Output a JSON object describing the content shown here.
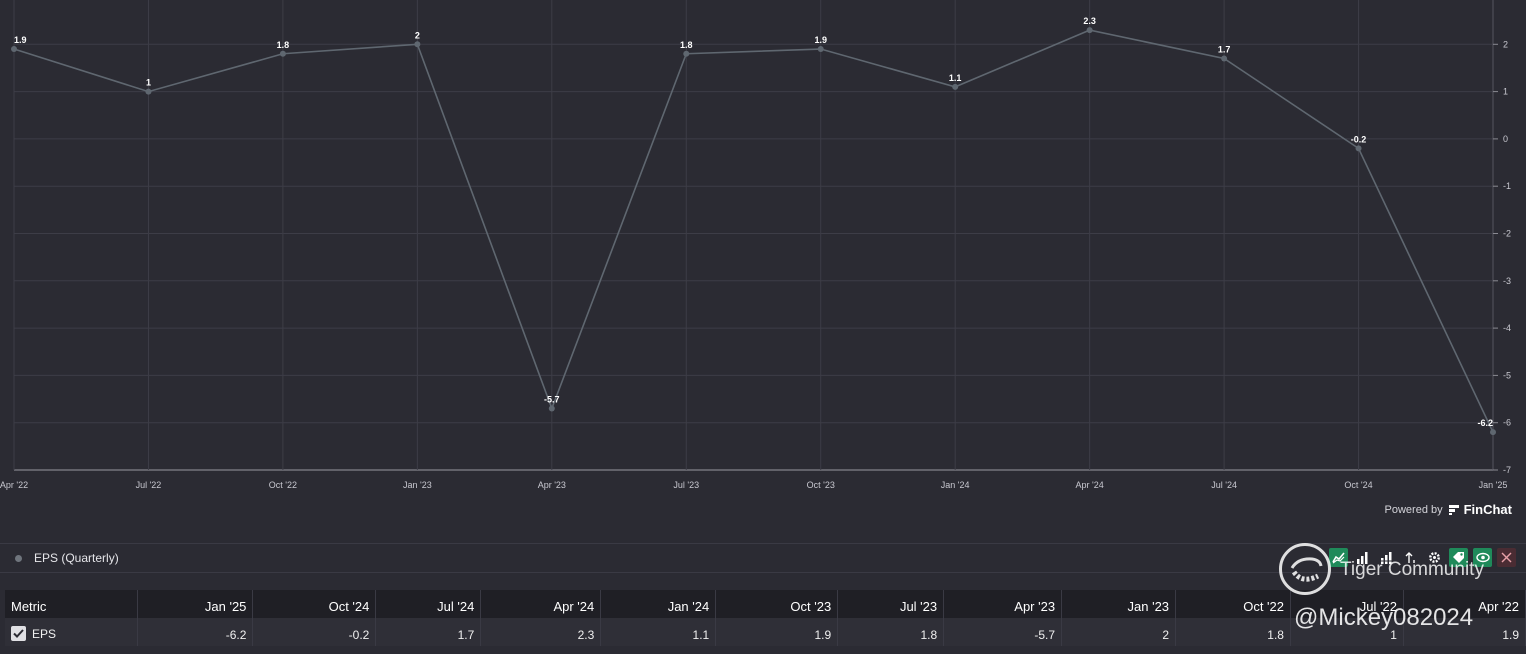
{
  "chart_data": {
    "type": "line",
    "x": [
      "Apr '22",
      "Jul '22",
      "Oct '22",
      "Jan '23",
      "Apr '23",
      "Jul '23",
      "Oct '23",
      "Jan '24",
      "Apr '24",
      "Jul '24",
      "Oct '24",
      "Jan '25"
    ],
    "series": [
      {
        "name": "EPS (Quarterly)",
        "values": [
          1.9,
          1,
          1.8,
          2,
          -5.7,
          1.8,
          1.9,
          1.1,
          2.3,
          1.7,
          -0.2,
          -6.2
        ]
      }
    ],
    "data_labels": [
      "1.9",
      "1",
      "1.8",
      "2",
      "-5.7",
      "1.8",
      "1.9",
      "1.1",
      "2.3",
      "1.7",
      "-0.2",
      "-6.2"
    ],
    "ylim": [
      -7,
      3
    ],
    "yticks": [
      2,
      1,
      0,
      -1,
      -2,
      -3,
      -4,
      -5,
      -6,
      -7
    ],
    "y_axis_side": "right",
    "grid": true,
    "line_color": "#5f6770",
    "point_color": "#5f6770",
    "background": "#2b2b33"
  },
  "powered": {
    "prefix": "Powered by",
    "brand": "FinChat"
  },
  "legend": {
    "label": "EPS (Quarterly)"
  },
  "table": {
    "headers": [
      "Metric",
      "Jan '25",
      "Oct '24",
      "Jul '24",
      "Apr '24",
      "Jan '24",
      "Oct '23",
      "Jul '23",
      "Apr '23",
      "Jan '23",
      "Oct '22",
      "Jul '22",
      "Apr '22"
    ],
    "rows": [
      {
        "metric": "EPS",
        "values": [
          "-6.2",
          "-0.2",
          "1.7",
          "2.3",
          "1.1",
          "1.9",
          "1.8",
          "-5.7",
          "2",
          "1.8",
          "1",
          "1.9"
        ]
      }
    ]
  },
  "watermark": {
    "community": "Tiger Community",
    "handle": "@Mickey082024"
  }
}
